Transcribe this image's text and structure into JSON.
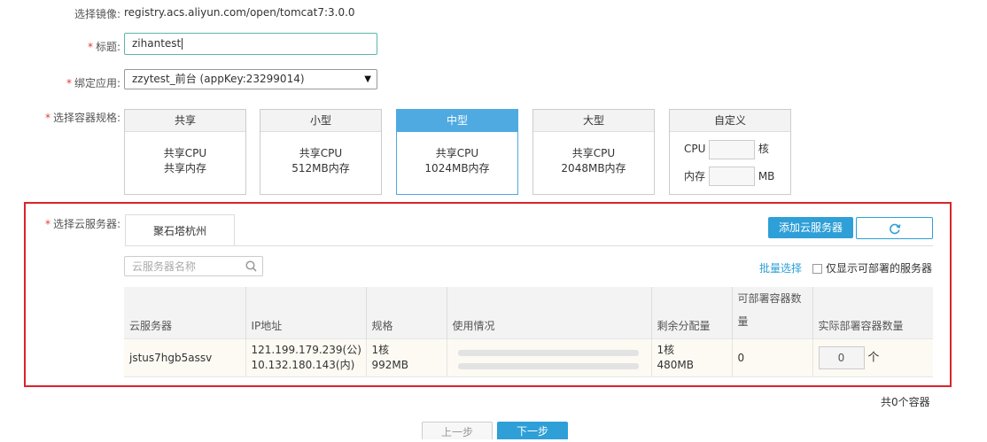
{
  "form": {
    "image_label": "选择镜像:",
    "image_value": "registry.acs.aliyun.com/open/tomcat7:3.0.0",
    "title_label": "标题:",
    "title_value": "zihantest",
    "bind_label": "绑定应用:",
    "bind_value": "zzytest_前台 (appKey:23299014)",
    "spec_label": "选择容器规格:",
    "server_label": "选择云服务器:",
    "required_mark": "*"
  },
  "specs": [
    {
      "name": "共享",
      "line1": "共享CPU",
      "line2": "共享内存",
      "selected": false
    },
    {
      "name": "小型",
      "line1": "共享CPU",
      "line2": "512MB内存",
      "selected": false
    },
    {
      "name": "中型",
      "line1": "共享CPU",
      "line2": "1024MB内存",
      "selected": true
    },
    {
      "name": "大型",
      "line1": "共享CPU",
      "line2": "2048MB内存",
      "selected": false
    }
  ],
  "custom_spec": {
    "name": "自定义",
    "cpu_label": "CPU",
    "cpu_unit": "核",
    "mem_label": "内存",
    "mem_unit": "MB"
  },
  "servers": {
    "tab": "聚石塔杭州",
    "add_button": "添加云服务器",
    "search_placeholder": "云服务器名称",
    "batch_select": "批量选择",
    "only_deployable": "仅显示可部署的服务器",
    "columns": [
      "云服务器",
      "IP地址",
      "规格",
      "使用情况",
      "剩余分配量",
      "可部署容器数量",
      "实际部署容器数量"
    ],
    "row": {
      "name": "jstus7hgb5assv",
      "ip_public": "121.199.179.239(公)",
      "ip_private": "10.132.180.143(内)",
      "spec_cpu": "1核",
      "spec_mem": "992MB",
      "remain_cpu": "1核",
      "remain_mem": "480MB",
      "deployable": "0",
      "actual": "0",
      "actual_unit": "个"
    },
    "total": "共0个容器"
  },
  "nav": {
    "prev": "上一步",
    "next": "下一步"
  },
  "colors": {
    "accent": "#2e9fd7",
    "selected_spec": "#4eaae0",
    "highlight_border": "#d9242a",
    "required": "#e4393c"
  }
}
